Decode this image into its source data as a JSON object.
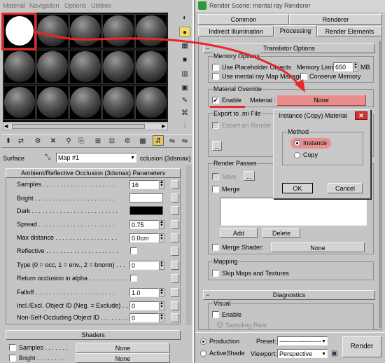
{
  "left": {
    "menu": [
      "Material",
      "Navigation",
      "Options",
      "Utilities"
    ],
    "surface_label": "Surface",
    "map_name": "Map #1",
    "map_type": "cclusion (3dsmax)",
    "params_title": "Ambient/Reflective Occlusion (3dsmax) Parameters",
    "params": {
      "samples": {
        "label": "Samples . . . . . . . . . . . . . . . . . . . . .",
        "value": "16"
      },
      "bright": {
        "label": "Bright . . . . . . . . . . . . . . . . . . . . . . ."
      },
      "dark": {
        "label": "Dark . . . . . . . . . . . . . . . . . . . . . . . . ."
      },
      "spread": {
        "label": "Spread . . . . . . . . . . . . . . . . . . . . . .",
        "value": "0.75"
      },
      "max_distance": {
        "label": "Max distance . . . . . . . . . . . . . . . . . .",
        "value": "0.0cm"
      },
      "reflective": {
        "label": "Reflective . . . . . . . . . . . . . . . . . . . . ."
      },
      "type": {
        "label": "Type (0 = occ, 1 = env., 2 = bnorm) . . .",
        "value": "0"
      },
      "return_occ": {
        "label": "Return occlusion in alpha . . . . . . . . . . ."
      },
      "falloff": {
        "label": "Falloff . . . . . . . . . . . . . . . . . . . . . . .",
        "value": "1.0"
      },
      "incl_excl": {
        "label": "Incl./Excl. Object ID (Neg. = Exclude) . . .",
        "value": "0"
      },
      "non_self": {
        "label": "Non-Self-Occluding Object ID . . . . . . . . .",
        "value": "0"
      }
    },
    "shaders_title": "Shaders",
    "shaders": [
      {
        "label": "Samples . . . . . . .",
        "value": "None"
      },
      {
        "label": "Bright . . . . . . . .",
        "value": "None"
      }
    ],
    "colors": {
      "bright": "#ffffff",
      "dark": "#000000",
      "highlight": "#e8262b"
    }
  },
  "render": {
    "title": "Render Scene: mental ray Renderer",
    "tabs_row1": [
      "Common",
      "Renderer"
    ],
    "tabs_row2": [
      "Indirect Illumination",
      "Processing",
      "Render Elements"
    ],
    "translator_title": "Translator Options",
    "memory": {
      "group": "Memory Options",
      "use_placeholder": "Use Placeholder Objects",
      "memory_limit_label": "Memory Limit:",
      "memory_limit_value": "650",
      "memory_unit": "MB",
      "use_map_manager": "Use mental ray Map Manager",
      "conserve_memory": "Conserve Memory"
    },
    "override": {
      "group": "Material Override",
      "enable": "Enable",
      "material_label": "Material :",
      "material_value": "None"
    },
    "export": {
      "group": "Export to .mi File",
      "export_on_render": "Export on Render",
      "browse": "..."
    },
    "passes": {
      "group": "Render Passes",
      "save": "Save",
      "browse": "...",
      "merge": "Merge",
      "add": "Add",
      "delete": "Delete",
      "merge_shader": "Merge Shader:",
      "merge_shader_value": "None"
    },
    "mapping": {
      "group": "Mapping",
      "skip_maps": "Skip Maps and Textures"
    },
    "diagnostics_title": "Diagnostics",
    "visual": {
      "group": "Visual",
      "enable": "Enable",
      "sampling_rate": "Sampling Rate"
    },
    "bottom": {
      "production": "Production",
      "activeshade": "ActiveShade",
      "preset_label": "Preset:",
      "preset_value": "--------------------",
      "viewport_label": "Viewport:",
      "viewport_value": "Perspective",
      "render_button": "Render"
    }
  },
  "dialog": {
    "title": "Instance (Copy) Material",
    "method_group": "Method",
    "instance": "Instance",
    "copy": "Copy",
    "ok": "OK",
    "cancel": "Cancel"
  }
}
